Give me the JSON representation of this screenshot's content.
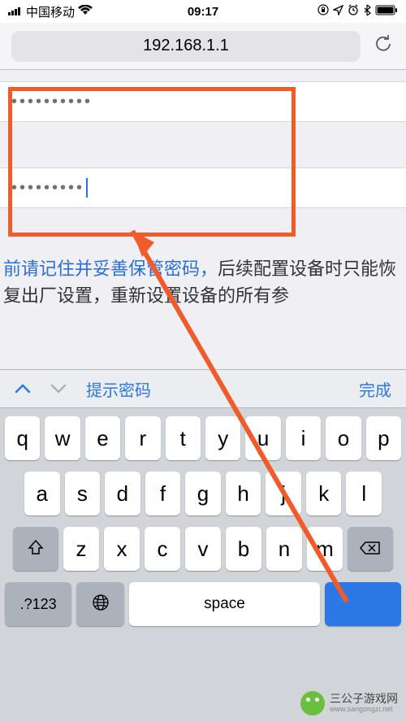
{
  "status": {
    "carrier": "中国移动",
    "time": "09:17"
  },
  "browser": {
    "url": "192.168.1.1"
  },
  "inputs": {
    "password1": "••••••••••",
    "password2": "•••••••••"
  },
  "help": {
    "blue_part": "前请记住并妥善保管密码，",
    "black_part": "后续配置设备时只能恢复出厂设置，重新设置设备的所有参"
  },
  "accessory": {
    "suggest": "提示密码",
    "done": "完成"
  },
  "keyboard": {
    "row1": [
      "q",
      "w",
      "e",
      "r",
      "t",
      "y",
      "u",
      "i",
      "o",
      "p"
    ],
    "row2": [
      "a",
      "s",
      "d",
      "f",
      "g",
      "h",
      "j",
      "k",
      "l"
    ],
    "row3": [
      "z",
      "x",
      "c",
      "v",
      "b",
      "n",
      "m"
    ],
    "numkey": ".?123",
    "space": "space"
  },
  "watermark": {
    "name": "三公子游戏网",
    "url": "www.sangongzi.net"
  }
}
